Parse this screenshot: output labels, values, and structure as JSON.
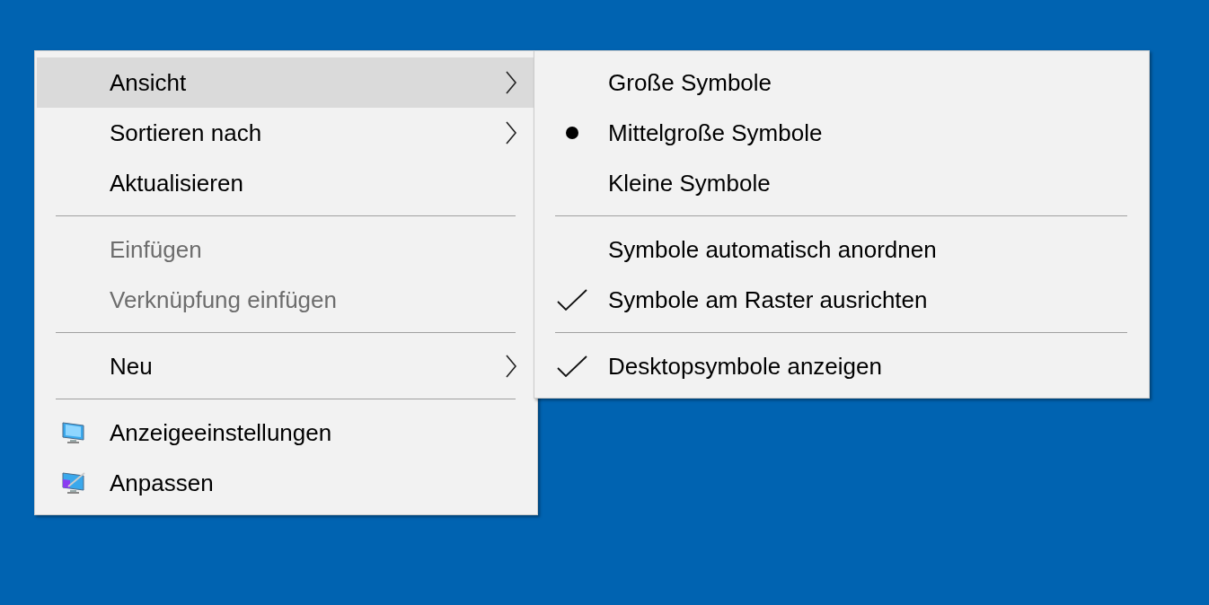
{
  "context_menu": {
    "items": [
      {
        "kind": "item",
        "label": "Ansicht",
        "highlighted": true,
        "disabled": false,
        "submenu": true
      },
      {
        "kind": "item",
        "label": "Sortieren nach",
        "highlighted": false,
        "disabled": false,
        "submenu": true
      },
      {
        "kind": "item",
        "label": "Aktualisieren",
        "highlighted": false,
        "disabled": false,
        "submenu": false
      },
      {
        "kind": "separator"
      },
      {
        "kind": "item",
        "label": "Einfügen",
        "highlighted": false,
        "disabled": true,
        "submenu": false
      },
      {
        "kind": "item",
        "label": "Verknüpfung einfügen",
        "highlighted": false,
        "disabled": true,
        "submenu": false
      },
      {
        "kind": "separator"
      },
      {
        "kind": "item",
        "label": "Neu",
        "highlighted": false,
        "disabled": false,
        "submenu": true
      },
      {
        "kind": "separator"
      },
      {
        "kind": "display",
        "label": "Anzeigeeinstellungen",
        "highlighted": false,
        "disabled": false,
        "submenu": false
      },
      {
        "kind": "personalize",
        "label": "Anpassen",
        "highlighted": false,
        "disabled": false,
        "submenu": false
      }
    ]
  },
  "submenu": {
    "items": [
      {
        "kind": "radio",
        "label": "Große Symbole",
        "selected": false
      },
      {
        "kind": "radio",
        "label": "Mittelgroße Symbole",
        "selected": true
      },
      {
        "kind": "radio",
        "label": "Kleine Symbole",
        "selected": false
      },
      {
        "kind": "separator"
      },
      {
        "kind": "check",
        "label": "Symbole automatisch anordnen",
        "checked": false
      },
      {
        "kind": "check",
        "label": "Symbole am Raster ausrichten",
        "checked": true
      },
      {
        "kind": "separator"
      },
      {
        "kind": "check",
        "label": "Desktopsymbole anzeigen",
        "checked": true
      }
    ]
  }
}
